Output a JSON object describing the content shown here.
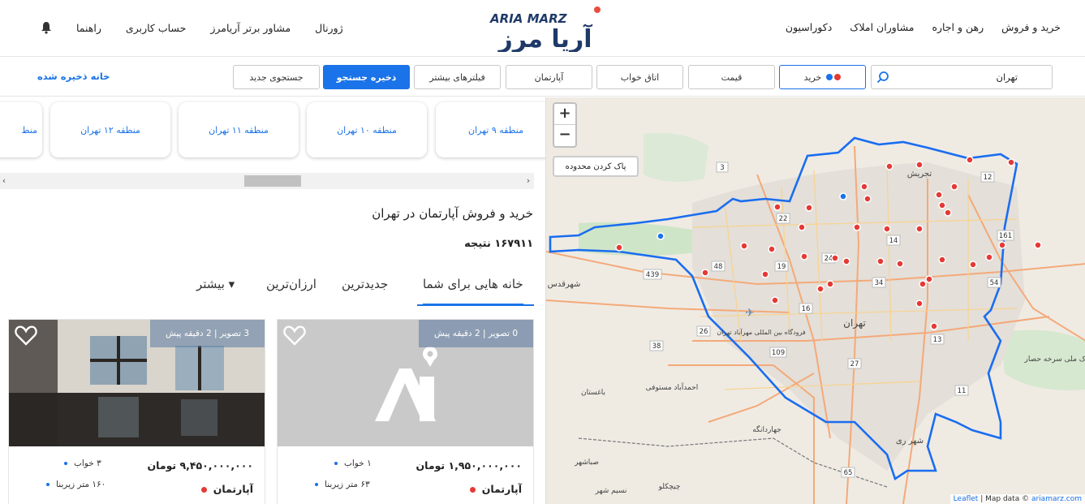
{
  "header": {
    "logo_latin": "ARIA MARZ",
    "logo_persian": "آریا مرز",
    "nav_right": [
      "خرید و فروش",
      "رهن و اجاره",
      "مشاوران املاک",
      "دکوراسیون"
    ],
    "nav_left": [
      "ژورنال",
      "مشاور برتر آریامرز",
      "حساب کاربری",
      "راهنما"
    ]
  },
  "filters": {
    "search_value": "تهران",
    "buy_label": "خرید",
    "price_label": "قیمت",
    "rooms_label": "اتاق خواب",
    "type_label": "آپارتمان",
    "more_filters_label": "فیلترهای بیشتر",
    "save_search_label": "ذخیره جستجو",
    "new_search_label": "جستجوی جدید",
    "saved_homes_label": "خانه ذخیره شده",
    "colors": {
      "accent": "#1a73e8",
      "dot_red": "#e53935",
      "dot_blue": "#1a73e8"
    }
  },
  "districts": [
    "منطقه ۹ تهران",
    "منطقه ۱۰ تهران",
    "منطقه ۱۱ تهران",
    "منطقه ۱۲ تهران",
    "منط"
  ],
  "results": {
    "title": "خرید و فروش آپارتمان در تهران",
    "count": "۱۶۷۹۱۱ نتیجه"
  },
  "tabs": [
    "خانه هایی برای شما",
    "جدیدترین",
    "ارزان‌ترین",
    "بیشتر ▾"
  ],
  "listings": [
    {
      "badge": "0 تصویر | 2 دقیقه پیش",
      "price": "۱,۹۵۰,۰۰۰,۰۰۰ تومان",
      "type": "آپارتمان",
      "beds": "۱ خواب",
      "area": "۶۳ متر زیربنا",
      "has_photo": false
    },
    {
      "badge": "3 تصویر | 2 دقیقه پیش",
      "price": "۹,۴۵۰,۰۰۰,۰۰۰ تومان",
      "type": "آپارتمان",
      "beds": "۳ خواب",
      "area": "۱۶۰ متر زیربنا",
      "has_photo": true
    }
  ],
  "map": {
    "zoom_in": "+",
    "zoom_out": "−",
    "clear_area_label": "پاک کردن محدوده",
    "attribution_leaflet": "Leaflet",
    "attribution_text": "| Map data ©",
    "attribution_site": "ariamarz.com",
    "labels": [
      "تهران",
      "شهرقدس",
      "تجریش",
      "شهر ری",
      "فرودگاه بین المللی مهرآباد تهران",
      "احمدآباد مستوفی",
      "باغستان",
      "صباشهر",
      "نسیم شهر",
      "چیچکلو",
      "جهاردانگه",
      "پارک ملی سرخه حصار"
    ],
    "route_numbers": [
      "3",
      "12",
      "22",
      "48",
      "439",
      "19",
      "24",
      "14",
      "161",
      "34",
      "16",
      "26",
      "109",
      "27",
      "13",
      "38",
      "11",
      "54",
      "65"
    ]
  }
}
